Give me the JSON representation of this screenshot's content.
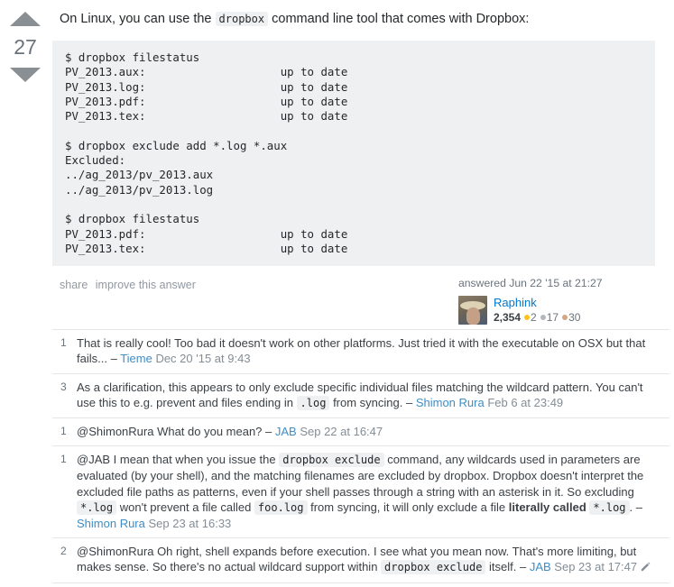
{
  "vote": {
    "up_icon": "arrow-up-icon",
    "down_icon": "arrow-down-icon",
    "score": "27"
  },
  "answer": {
    "paragraph": {
      "before": "On Linux, you can use the",
      "code": "dropbox",
      "after": "command line tool that comes with Dropbox:"
    },
    "code_block": "$ dropbox filestatus\nPV_2013.aux:                    up to date\nPV_2013.log:                    up to date\nPV_2013.pdf:                    up to date\nPV_2013.tex:                    up to date\n\n$ dropbox exclude add *.log *.aux\nExcluded:\n../ag_2013/pv_2013.aux\n../ag_2013/pv_2013.log\n\n$ dropbox filestatus\nPV_2013.pdf:                    up to date\nPV_2013.tex:                    up to date",
    "post_menu": {
      "share": "share",
      "improve": "improve this answer"
    },
    "signature": {
      "answered_line": "answered Jun 22 '15 at 21:27",
      "user": "Raphink",
      "reputation": "2,354",
      "gold": "2",
      "silver": "17",
      "bronze": "30"
    }
  },
  "comments": [
    {
      "score": "1",
      "parts": [
        {
          "t": "text",
          "v": "That is really cool! Too bad it doesn't work on other platforms. Just tried it with the executable on OSX but that fails... "
        },
        {
          "t": "dash",
          "v": "– "
        },
        {
          "t": "user",
          "v": "Tieme"
        },
        {
          "t": "date",
          "v": " Dec 20 '15 at 9:43"
        }
      ]
    },
    {
      "score": "3",
      "parts": [
        {
          "t": "text",
          "v": "As a clarification, this appears to only exclude specific individual files matching the wildcard pattern. You can't use this to e.g. prevent and files ending in "
        },
        {
          "t": "code",
          "v": ".log"
        },
        {
          "t": "text",
          "v": " from syncing. "
        },
        {
          "t": "dash",
          "v": "– "
        },
        {
          "t": "user",
          "v": "Shimon Rura"
        },
        {
          "t": "date",
          "v": " Feb 6 at 23:49"
        }
      ]
    },
    {
      "score": "1",
      "parts": [
        {
          "t": "text",
          "v": "@ShimonRura What do you mean? "
        },
        {
          "t": "dash",
          "v": "– "
        },
        {
          "t": "user",
          "v": "JAB"
        },
        {
          "t": "date",
          "v": " Sep 22 at 16:47"
        }
      ]
    },
    {
      "score": "1",
      "parts": [
        {
          "t": "text",
          "v": "@JAB I mean that when you issue the "
        },
        {
          "t": "code",
          "v": "dropbox exclude"
        },
        {
          "t": "text",
          "v": " command, any wildcards used in parameters are evaluated (by your shell), and the matching filenames are excluded by dropbox. Dropbox doesn't interpret the excluded file paths as patterns, even if your shell passes through a string with an asterisk in it. So excluding "
        },
        {
          "t": "code",
          "v": "*.log"
        },
        {
          "t": "text",
          "v": " won't prevent a file called "
        },
        {
          "t": "code",
          "v": "foo.log"
        },
        {
          "t": "text",
          "v": " from syncing, it will only exclude a file "
        },
        {
          "t": "bold",
          "v": "literally called"
        },
        {
          "t": "text",
          "v": " "
        },
        {
          "t": "code",
          "v": "*.log"
        },
        {
          "t": "text",
          "v": ". "
        },
        {
          "t": "dash",
          "v": "– "
        },
        {
          "t": "user",
          "v": "Shimon Rura"
        },
        {
          "t": "date",
          "v": " Sep 23 at 16:33"
        }
      ]
    },
    {
      "score": "2",
      "parts": [
        {
          "t": "text",
          "v": "@ShimonRura Oh right, shell expands before execution. I see what you mean now. That's more limiting, but makes sense. So there's no actual wildcard support within "
        },
        {
          "t": "code",
          "v": "dropbox exclude"
        },
        {
          "t": "text",
          "v": " itself. "
        },
        {
          "t": "dash",
          "v": "– "
        },
        {
          "t": "user",
          "v": "JAB"
        },
        {
          "t": "date",
          "v": " Sep 23 at 17:47"
        },
        {
          "t": "pencil",
          "v": "edit-pencil-icon"
        }
      ]
    }
  ],
  "colors": {
    "link": "#0077cc",
    "comment_link": "#3f8dc4",
    "code_bg": "#eff0f1",
    "muted": "#848d95",
    "gold": "#fcc419",
    "silver": "#b4b8bc",
    "bronze": "#d1a684"
  }
}
